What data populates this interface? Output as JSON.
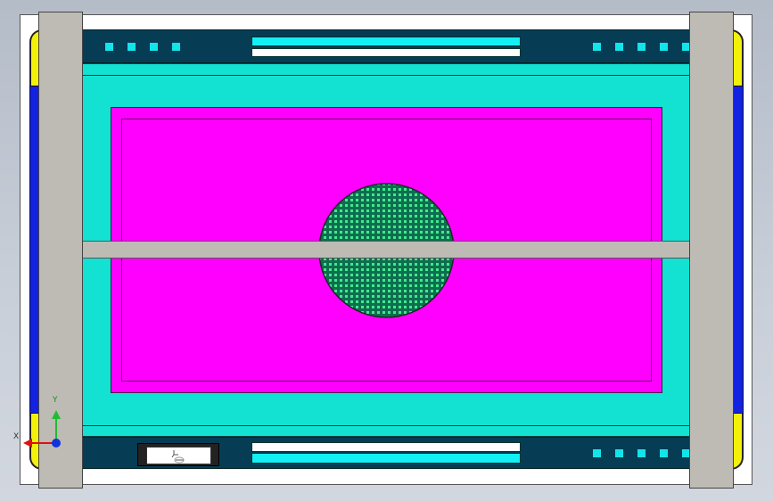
{
  "viewport": {
    "type": "cad-3d-view",
    "view": "top"
  },
  "triad": {
    "x_label": "X",
    "y_label": "Y",
    "x_color": "#dd1111",
    "y_color": "#22bb33",
    "z_color": "#1133dd"
  },
  "colors": {
    "background": "#c8ced8",
    "outer_plate": "#ffffff",
    "side_rails": "#bdbbb3",
    "blue_strips": "#1322e0",
    "yellow_corners": "#f3f00a",
    "dark_bars": "#063d54",
    "teal_body": "#13e2d2",
    "cyan_slots": "#13f0f4",
    "magenta_tray": "#ff00ff",
    "mesh_disc": "#0e6e4e",
    "mesh_dots": "#42e890"
  }
}
